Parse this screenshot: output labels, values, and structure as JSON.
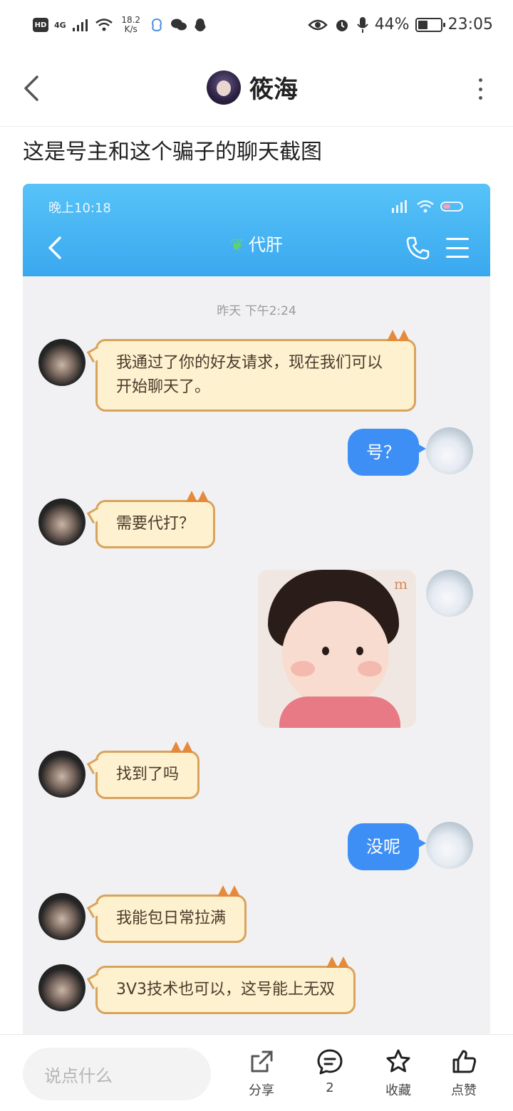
{
  "status_bar": {
    "hd": "HD",
    "network": "4G",
    "speed_value": "18.2",
    "speed_unit": "K/s",
    "battery_percent_text": "44%",
    "battery_level": 0.44,
    "time": "23:05"
  },
  "header": {
    "author_name": "筱海"
  },
  "post": {
    "text": "这是号主和这个骗子的聊天截图"
  },
  "chat_screenshot": {
    "status_time": "晚上10:18",
    "contact_name": "代肝",
    "date_label": "昨天 下午2:24",
    "messages": [
      {
        "side": "left",
        "text": "我通过了你的好友请求，现在我们可以开始聊天了。"
      },
      {
        "side": "right",
        "text": "号？"
      },
      {
        "side": "left",
        "text": "需要代打？"
      },
      {
        "side": "right",
        "type": "image",
        "mark": "m"
      },
      {
        "side": "left",
        "text": "找到了吗"
      },
      {
        "side": "right",
        "text": "没呢"
      },
      {
        "side": "left",
        "text": "我能包日常拉满"
      },
      {
        "side": "left",
        "text": "3V3技术也可以，这号能上无双"
      }
    ]
  },
  "bottom_bar": {
    "comment_placeholder": "说点什么",
    "share_label": "分享",
    "comment_count": "2",
    "favorite_label": "收藏",
    "like_label": "点赞"
  }
}
